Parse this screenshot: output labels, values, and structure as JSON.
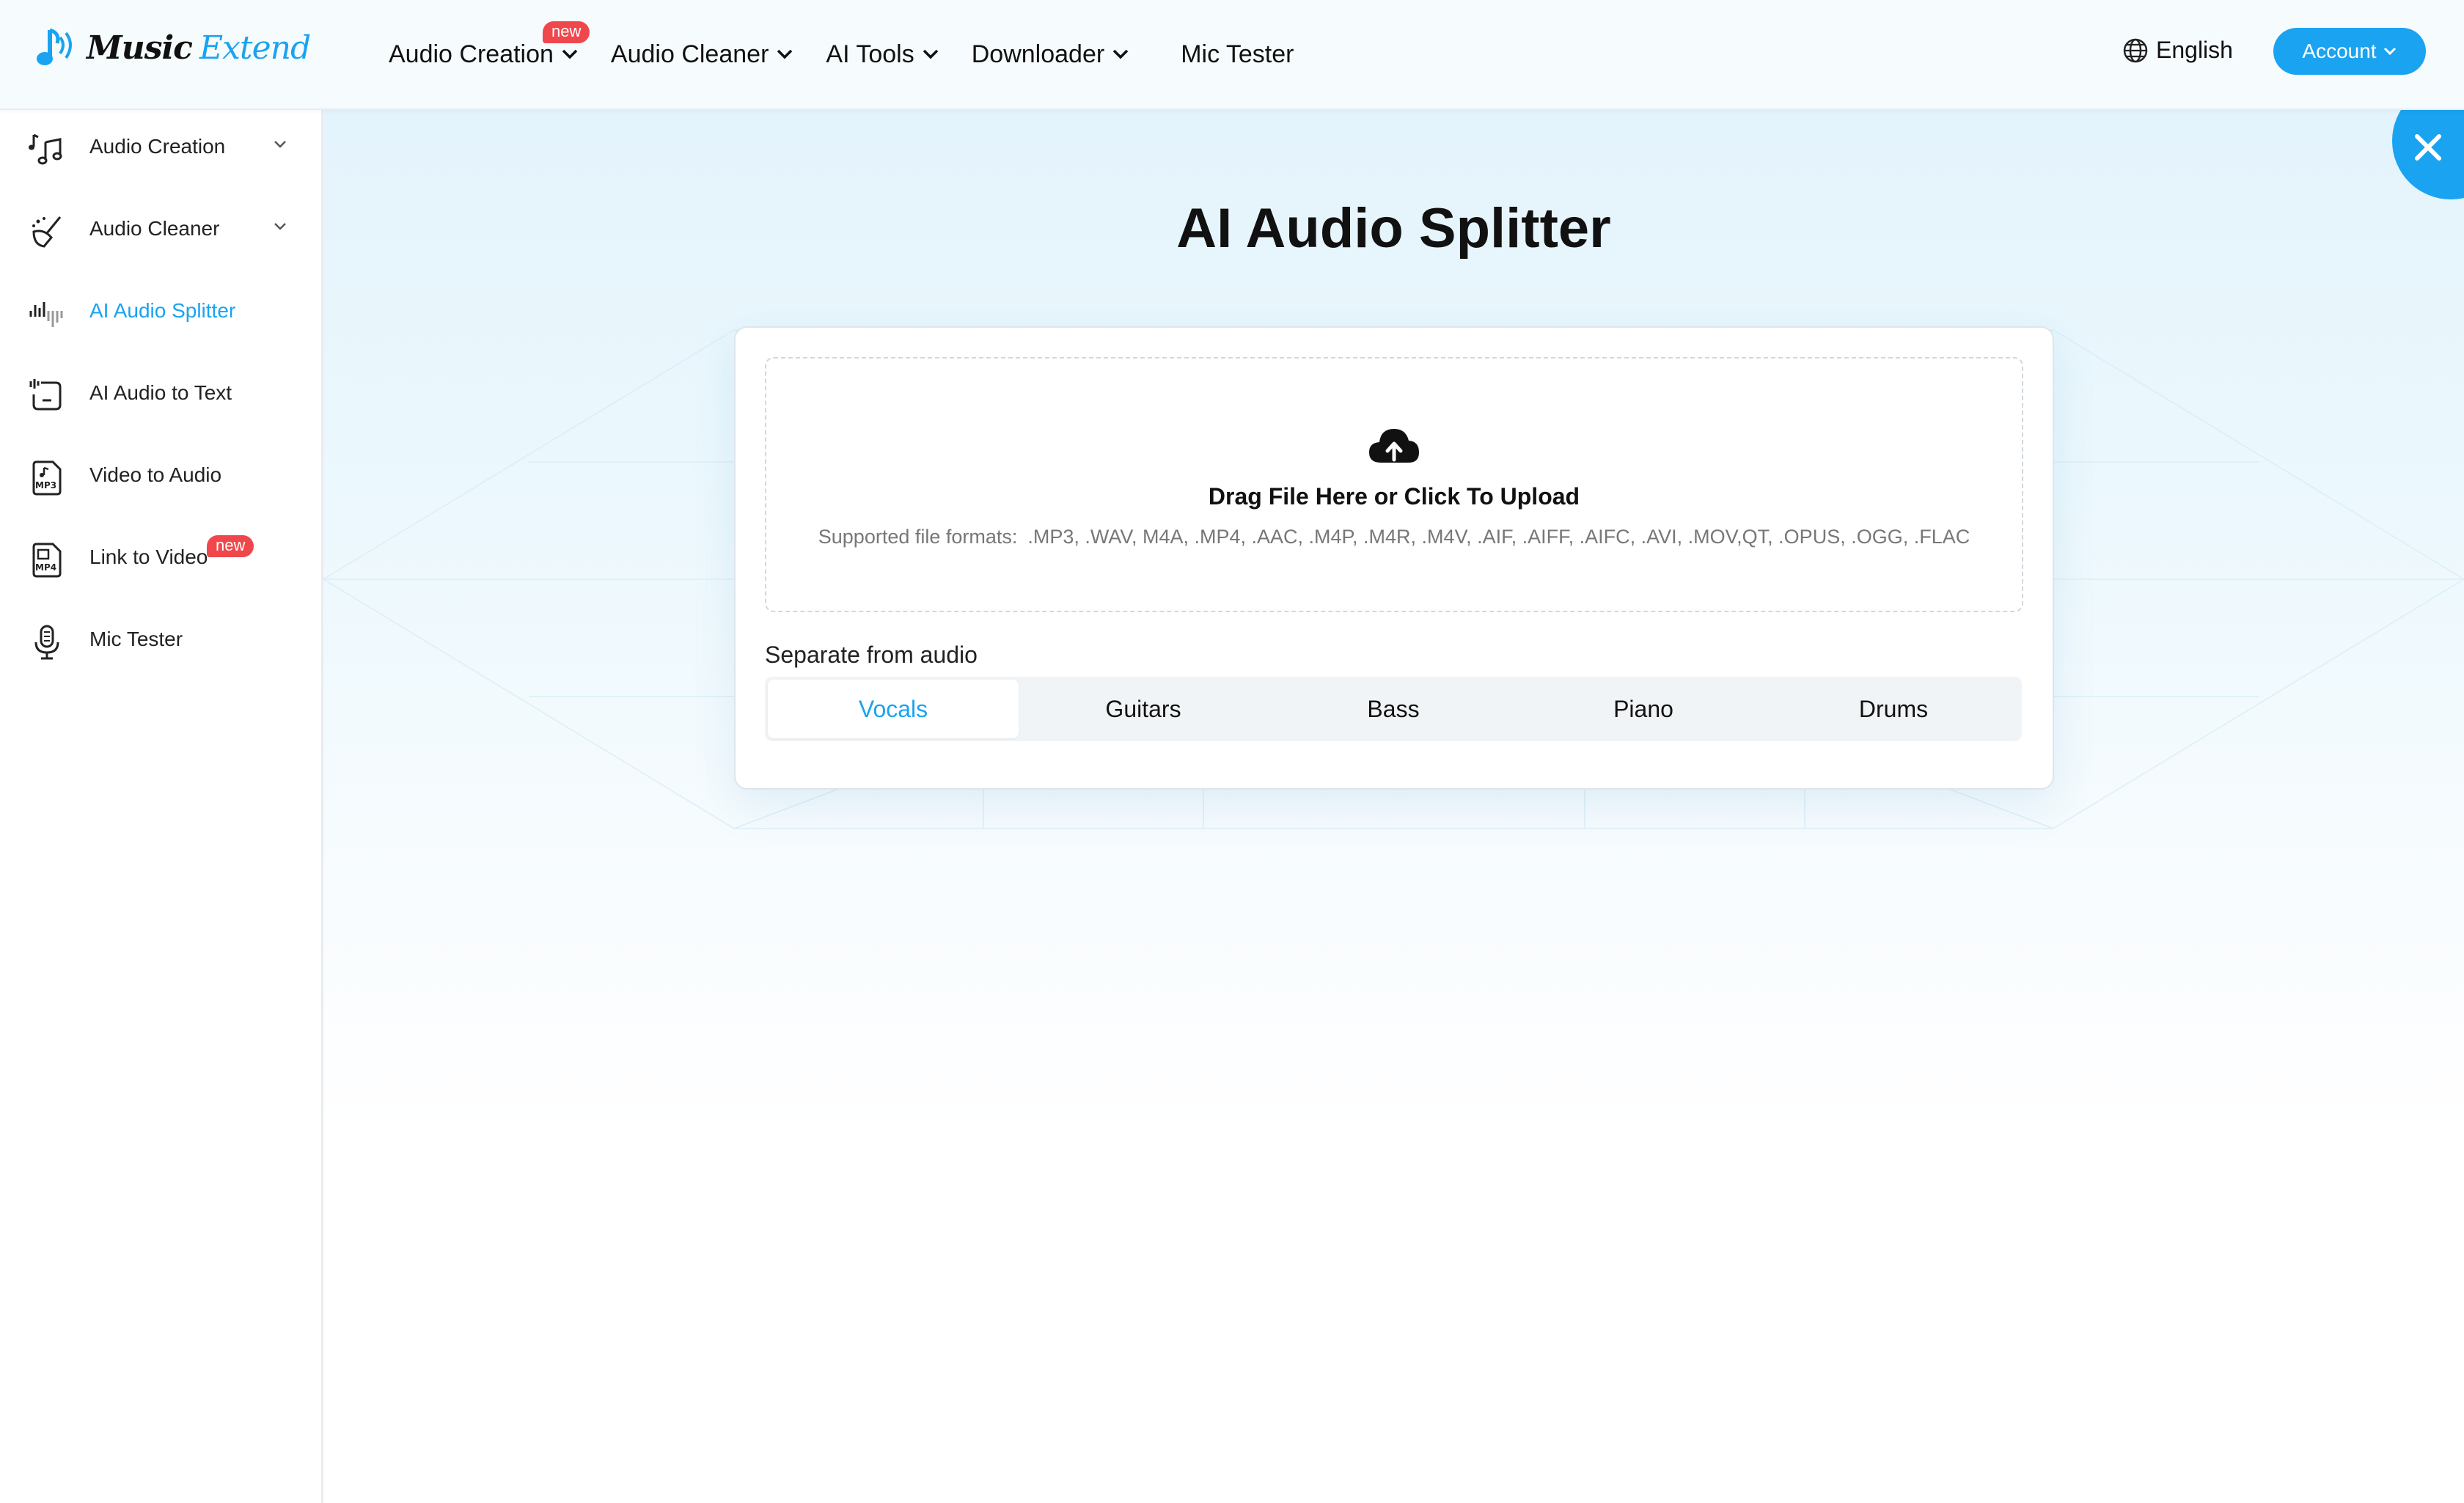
{
  "brand": {
    "word1": "Music",
    "word2": "Extend",
    "accent": "#1aa3f0"
  },
  "nav": {
    "items": [
      {
        "label": "Audio Creation",
        "badge": "new"
      },
      {
        "label": "Audio Cleaner"
      },
      {
        "label": "AI Tools"
      },
      {
        "label": "Downloader"
      }
    ],
    "mic_tester": "Mic Tester",
    "language": "English",
    "account": "Account"
  },
  "sidebar": {
    "items": [
      {
        "label": "Audio Creation",
        "icon": "music-notes-icon",
        "expandable": true
      },
      {
        "label": "Audio Cleaner",
        "icon": "broom-icon",
        "expandable": true
      },
      {
        "label": "AI Audio Splitter",
        "icon": "waveform-icon",
        "active": true
      },
      {
        "label": "AI Audio to Text",
        "icon": "audio-text-icon"
      },
      {
        "label": "Video to Audio",
        "icon": "mp3-file-icon"
      },
      {
        "label": "Link to Video",
        "icon": "mp4-file-icon",
        "badge": "new"
      },
      {
        "label": "Mic Tester",
        "icon": "microphone-icon"
      }
    ]
  },
  "main": {
    "title": "AI Audio Splitter",
    "upload": {
      "title": "Drag File Here or Click To Upload",
      "formats_label": "Supported file formats:",
      "formats": ".MP3, .WAV, M4A, .MP4, .AAC, .M4P, .M4R, .M4V, .AIF, .AIFF, .AIFC, .AVI, .MOV,QT, .OPUS, .OGG, .FLAC"
    },
    "separate_label": "Separate from audio",
    "tabs": [
      "Vocals",
      "Guitars",
      "Bass",
      "Piano",
      "Drums"
    ],
    "active_tab": "Vocals"
  },
  "colors": {
    "badge": "#f0474c",
    "accent": "#1aa3f0"
  }
}
